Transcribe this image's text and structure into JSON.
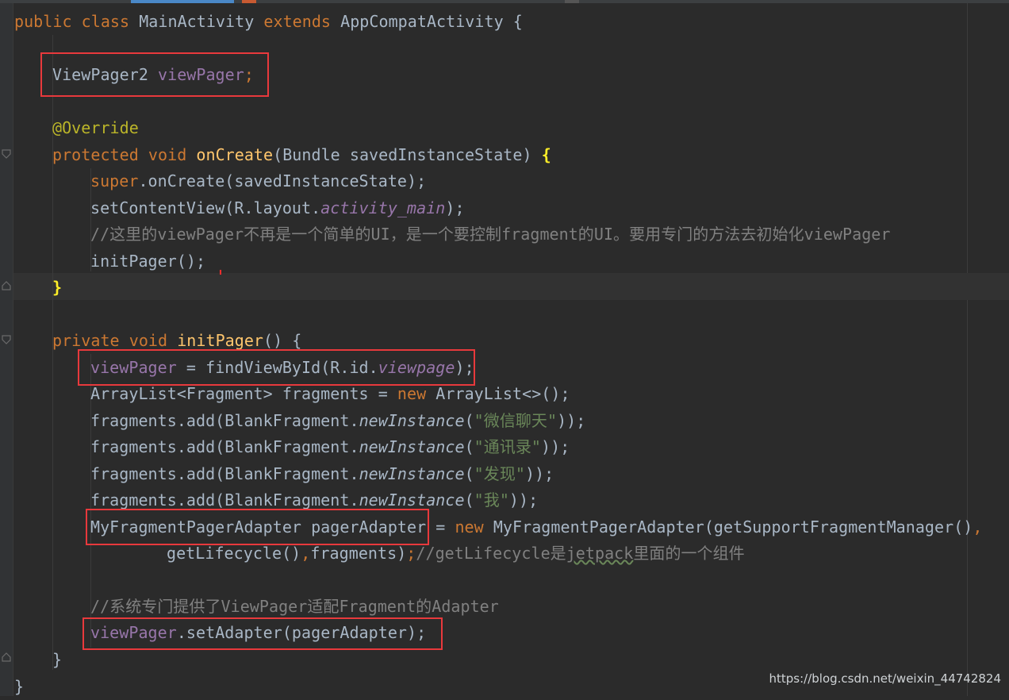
{
  "code_lines": [
    [
      "public class MainActivity extends AppCompatActivity {"
    ],
    [
      "ViewPager2 viewPager;"
    ],
    [
      "@Override"
    ],
    [
      "protected void onCreate(Bundle savedInstanceState) {"
    ],
    [
      "super.onCreate(savedInstanceState);"
    ],
    [
      "setContentView(R.layout.activity_main);"
    ],
    [
      "//这里的viewPager不再是一个简单的UI，是一个要控制fragment的UI。要用专门的方法去初始化viewPager"
    ],
    [
      "initPager();"
    ],
    [
      "}"
    ],
    [
      "private void initPager() {"
    ],
    [
      "viewPager = findViewById(R.id.viewpage);"
    ],
    [
      "ArrayList<Fragment> fragments = new ArrayList<>();"
    ],
    [
      "fragments.add(BlankFragment.newInstance(\"微信聊天\"));"
    ],
    [
      "fragments.add(BlankFragment.newInstance(\"通讯录\"));"
    ],
    [
      "fragments.add(BlankFragment.newInstance(\"发现\"));"
    ],
    [
      "fragments.add(BlankFragment.newInstance(\"我\"));"
    ],
    [
      "MyFragmentPagerAdapter pagerAdapter = new MyFragmentPagerAdapter(getSupportFragmentManager(),"
    ],
    [
      "getLifecycle(),fragments);//getLifecycle是jetpack里面的一个组件"
    ],
    [
      "//系统专门提供了ViewPager适配Fragment的Adapter"
    ],
    [
      "viewPager.setAdapter(pagerAdapter);"
    ],
    [
      "}"
    ],
    [
      "}"
    ]
  ],
  "tokens": {
    "public": "public",
    "class": "class",
    "main_activity": "MainActivity",
    "extends": "extends",
    "app_compat": "AppCompatActivity",
    "open_brace": " {",
    "close_brace": "}",
    "viewpager2": "ViewPager2",
    "view_pager": "viewPager",
    "semicolon": ";",
    "override": "@Override",
    "protected": "protected",
    "void": "void",
    "on_create": "onCreate",
    "bundle_params": "(Bundle savedInstanceState) ",
    "brace_hl_open": "{",
    "brace_hl_close": "}",
    "super": "super",
    "super_rest": ".onCreate(savedInstanceState);",
    "set_content": "setContentView(R.layout.",
    "activity_main": "activity_main",
    "paren_semi": ");",
    "comment_1": "//这里的viewPager不再是一个简单的UI，是一个要控制fragment的UI。要用专门的方法去初始化viewPager",
    "init_pager_call": "initPager();",
    "private": "private",
    "init_pager": "initPager",
    "init_pager_sig": "() {",
    "find_view": " = findViewById(R.id.",
    "viewpage": "viewpage",
    "arraylist_decl": "ArrayList<Fragment> fragments = ",
    "new": "new",
    "arraylist_new": " ArrayList<>();",
    "frag_add": "fragments.add(BlankFragment.",
    "new_instance": "newInstance",
    "open_paren": "(",
    "str_wechat": "\"微信聊天\"",
    "str_contacts": "\"通讯录\"",
    "str_discover": "\"发现\"",
    "str_me": "\"我\"",
    "close_semi": "));",
    "adapter_decl": "MyFragmentPagerAdapter pagerAdapter",
    "equals": " = ",
    "adapter_new": " MyFragmentPagerAdapter(getSupportFragmentManager()",
    "comma": ",",
    "get_lifecycle": "getLifecycle()",
    "fragments_arg": "fragments)",
    "comment_2a": "//getLifecycle是",
    "comment_2b": "jetpack",
    "comment_2c": "里面的一个组件",
    "comment_3": "//系统专门提供了ViewPager适配Fragment的Adapter",
    "set_adapter": ".setAdapter(pagerAdapter);"
  },
  "watermark": "https://blog.csdn.net/weixin_44742824",
  "colors": {
    "background": "#2b2b2b",
    "keyword": "#cc7832",
    "function": "#ffc66d",
    "field": "#9876aa",
    "string": "#6a8759",
    "comment": "#808080",
    "annotation": "#bbb529",
    "highlight_box": "#e8393c"
  }
}
